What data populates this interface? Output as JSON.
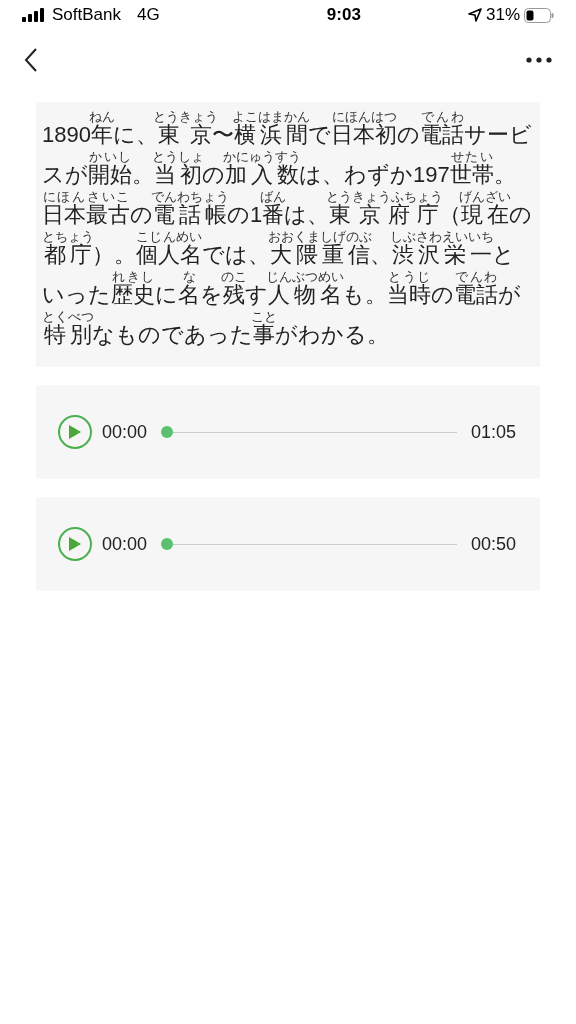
{
  "status_bar": {
    "carrier": "SoftBank",
    "network": "4G",
    "time": "9:03",
    "battery": "31%"
  },
  "passage": [
    {
      "text": "1890"
    },
    {
      "text": "年",
      "ruby": "ねん"
    },
    {
      "text": "に、"
    },
    {
      "text": "東京",
      "ruby": "とうきょう"
    },
    {
      "text": "〜"
    },
    {
      "text": "横浜間",
      "ruby": "よこはまかん"
    },
    {
      "text": "で"
    },
    {
      "text": "日本初",
      "ruby": "にほんはつ"
    },
    {
      "text": "の"
    },
    {
      "text": "電話",
      "ruby": "でんわ"
    },
    {
      "text": "サービスが"
    },
    {
      "text": "開始",
      "ruby": "かいし"
    },
    {
      "text": "。"
    },
    {
      "text": "当初",
      "ruby": "とうしょ"
    },
    {
      "text": "の"
    },
    {
      "text": "加入数",
      "ruby": "かにゅうすう"
    },
    {
      "text": "は、わずか197"
    },
    {
      "text": "世帯",
      "ruby": "せたい"
    },
    {
      "text": "。"
    },
    {
      "text": "日本最古",
      "ruby": "にほんさいこ"
    },
    {
      "text": "の"
    },
    {
      "text": "電話帳",
      "ruby": "でんわちょう"
    },
    {
      "text": "の1"
    },
    {
      "text": "番",
      "ruby": "ばん"
    },
    {
      "text": "は、"
    },
    {
      "text": "東京府庁",
      "ruby": "とうきょうふちょう"
    },
    {
      "text": "（"
    },
    {
      "text": "現在",
      "ruby": "げんざい"
    },
    {
      "text": "の"
    },
    {
      "text": "都庁",
      "ruby": "とちょう"
    },
    {
      "text": "）。"
    },
    {
      "text": "個人名",
      "ruby": "こじんめい"
    },
    {
      "text": "では、"
    },
    {
      "text": "大隈重信",
      "ruby": "おおくましげのぶ"
    },
    {
      "text": "、"
    },
    {
      "text": "渋沢栄一",
      "ruby": "しぶさわえいいち"
    },
    {
      "text": "といった"
    },
    {
      "text": "歴史",
      "ruby": "れきし"
    },
    {
      "text": "に"
    },
    {
      "text": "名",
      "ruby": "な"
    },
    {
      "text": "を"
    },
    {
      "text": "残",
      "ruby": "のこ"
    },
    {
      "text": "す"
    },
    {
      "text": "人物名",
      "ruby": "じんぶつめい"
    },
    {
      "text": "も。"
    },
    {
      "text": "当時",
      "ruby": "とうじ"
    },
    {
      "text": "の"
    },
    {
      "text": "電話",
      "ruby": "でんわ"
    },
    {
      "text": "が"
    },
    {
      "text": "特別",
      "ruby": "とくべつ"
    },
    {
      "text": "なものであった"
    },
    {
      "text": "事",
      "ruby": "こと"
    },
    {
      "text": "がわかる。"
    }
  ],
  "players": [
    {
      "elapsed": "00:00",
      "duration": "01:05",
      "level": 0
    },
    {
      "elapsed": "00:00",
      "duration": "00:50",
      "level": 0
    }
  ]
}
